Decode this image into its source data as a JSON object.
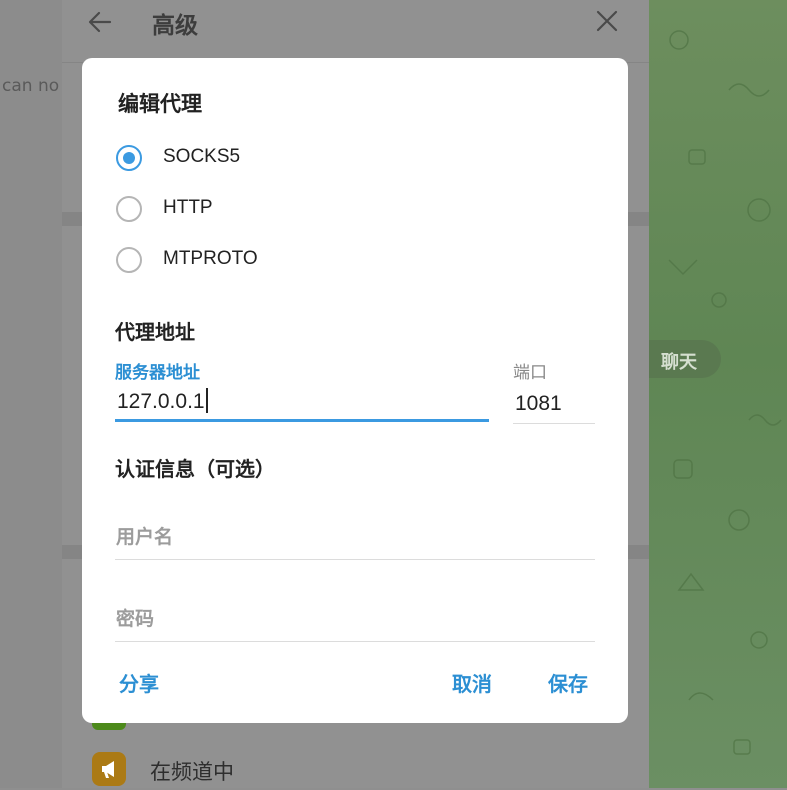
{
  "background": {
    "cut_text": "can no",
    "settings_title": "高级",
    "row_label": "在频道中",
    "chat_chip": "聊天"
  },
  "dialog": {
    "title": "编辑代理",
    "proxy_types": [
      {
        "label": "SOCKS5",
        "selected": true
      },
      {
        "label": "HTTP",
        "selected": false
      },
      {
        "label": "MTPROTO",
        "selected": false
      }
    ],
    "address_section": "代理地址",
    "server_label": "服务器地址",
    "server_value": "127.0.0.1",
    "port_label": "端口",
    "port_value": "1081",
    "auth_section": "认证信息（可选）",
    "username_placeholder": "用户名",
    "password_placeholder": "密码",
    "share_button": "分享",
    "cancel_button": "取消",
    "save_button": "保存"
  },
  "colors": {
    "accent": "#3b9ae1",
    "link": "#2c8fd3",
    "overlay": "#8f8f8f",
    "chat_bg": "#6b8f5e"
  }
}
